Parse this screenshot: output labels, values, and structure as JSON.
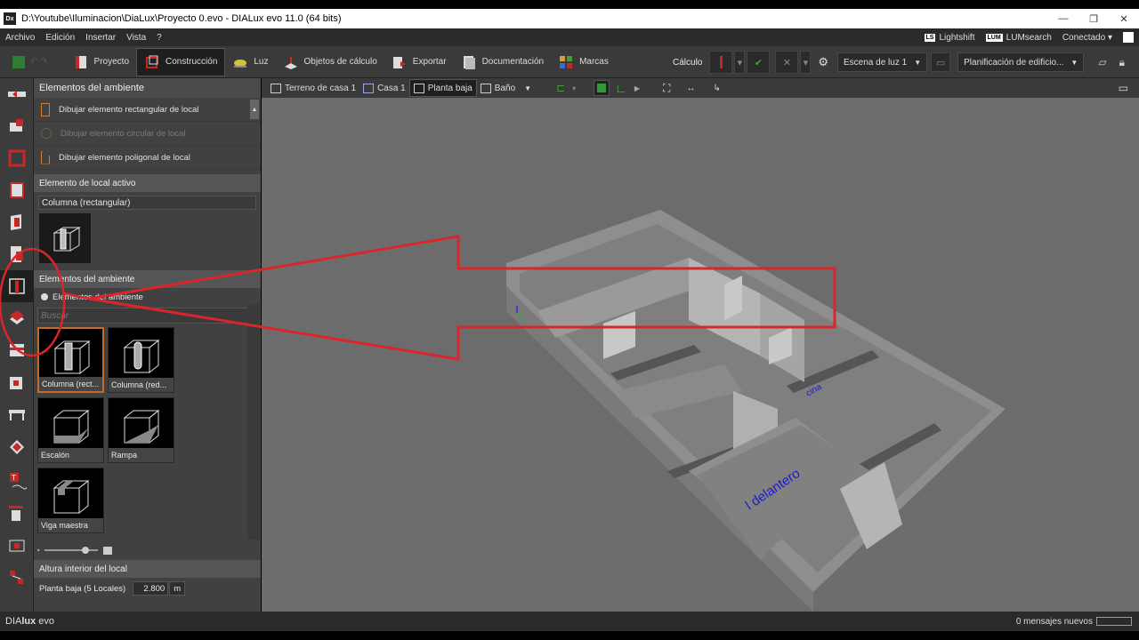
{
  "window": {
    "title": "D:\\Youtube\\Iluminacion\\DiaLux\\Proyecto 0.evo - DIALux evo 11.0  (64 bits)",
    "app_badge": "Dx"
  },
  "menu": {
    "items": [
      "Archivo",
      "Edición",
      "Insertar",
      "Vista",
      "?"
    ],
    "lightshift_badge": "LS",
    "lightshift": "Lightshift",
    "lumsearch_badge": "LUM",
    "lumsearch": "LUMsearch",
    "connection": "Conectado"
  },
  "toolbar": {
    "tabs": [
      "Proyecto",
      "Construcción",
      "Luz",
      "Objetos de cálculo",
      "Exportar",
      "Documentación",
      "Marcas"
    ],
    "active_tab": "Construcción",
    "calc_label": "Cálculo",
    "scene": "Escena de luz 1",
    "planning": "Planificación de edificio..."
  },
  "panel": {
    "header": "Elementos del ambiente",
    "draw_items": [
      "Dibujar elemento rectangular de local",
      "Dibujar elemento circular de local",
      "Dibujar elemento poligonal de local"
    ],
    "active_section": "Elemento de local activo",
    "active_value": "Columna (rectangular)",
    "elements_section": "Elementos del ambiente",
    "elements_radio": "Elementos del ambiente",
    "search_placeholder": "Buscar",
    "tiles": [
      "Columna (rect...",
      "Columna (red...",
      "Escalón",
      "Rampa",
      "Viga maestra"
    ],
    "height_section": "Altura interior del local",
    "height_label": "Planta baja (5 Locales)",
    "height_value": "2.800",
    "height_unit": "m"
  },
  "viewport": {
    "breadcrumbs": [
      "Terreno de casa 1",
      "Casa 1",
      "Planta baja",
      "Baño"
    ],
    "active_crumb": "Planta baja",
    "room_labels": [
      "l delantero",
      "cina"
    ]
  },
  "status": {
    "logo_dia": "DIA",
    "logo_lux": "lux",
    "logo_evo": " evo",
    "messages": "0 mensajes nuevos"
  }
}
